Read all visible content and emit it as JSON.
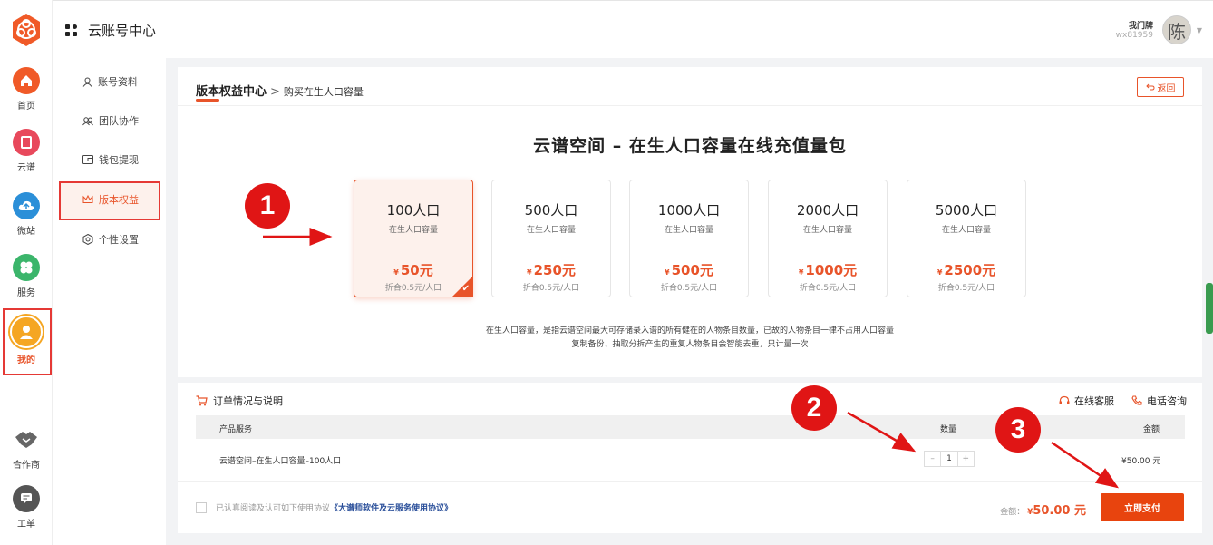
{
  "rail": {
    "items": [
      {
        "label": "首页",
        "icon": "home-icon",
        "color": "#f05a28"
      },
      {
        "label": "云谱",
        "icon": "book-icon",
        "color": "#e8495c"
      },
      {
        "label": "微站",
        "icon": "cloud-icon",
        "color": "#2b8fd8"
      },
      {
        "label": "服务",
        "icon": "clover-icon",
        "color": "#3bb56b"
      },
      {
        "label": "我的",
        "icon": "user-icon",
        "color": "#f5a623"
      },
      {
        "label": "合作商",
        "icon": "handshake-icon",
        "color": "#666666"
      },
      {
        "label": "工单",
        "icon": "chat-icon",
        "color": "#555555"
      }
    ]
  },
  "nav2": {
    "items": [
      {
        "label": "账号资料",
        "icon": "user-outline-icon"
      },
      {
        "label": "团队协作",
        "icon": "team-icon"
      },
      {
        "label": "钱包提现",
        "icon": "wallet-icon"
      },
      {
        "label": "版本权益",
        "icon": "crown-icon"
      },
      {
        "label": "个性设置",
        "icon": "settings-icon"
      }
    ]
  },
  "header": {
    "title": "云账号中心",
    "user_name": "我门牌",
    "user_id": "wx81959",
    "avatar_char": "陈"
  },
  "page": {
    "crumb_main": "版本权益中心",
    "crumb_sep": ">",
    "crumb_sub": "购买在生人口容量",
    "back_label": "返回",
    "title": "云谱空间 – 在生人口容量在线充值量包",
    "note_line1": "在生人口容量，是指云谱空间最大可存储录入谱的所有健在的人物条目数量，已故的人物条目一律不占用人口容量",
    "note_line2": "复制备份、抽取分拆产生的重复人物条目会智能去重，只计量一次"
  },
  "packages": [
    {
      "name": "100人口",
      "sub": "在生人口容量",
      "price": "50元",
      "disc": "折合0.5元/人口",
      "selected": true
    },
    {
      "name": "500人口",
      "sub": "在生人口容量",
      "price": "250元",
      "disc": "折合0.5元/人口",
      "selected": false
    },
    {
      "name": "1000人口",
      "sub": "在生人口容量",
      "price": "500元",
      "disc": "折合0.5元/人口",
      "selected": false
    },
    {
      "name": "2000人口",
      "sub": "在生人口容量",
      "price": "1000元",
      "disc": "折合0.5元/人口",
      "selected": false
    },
    {
      "name": "5000人口",
      "sub": "在生人口容量",
      "price": "2500元",
      "disc": "折合0.5元/人口",
      "selected": false
    }
  ],
  "currency_symbol": "¥",
  "order": {
    "title": "订单情况与说明",
    "online_service": "在线客服",
    "phone_consult": "电话咨询",
    "col_product": "产品服务",
    "col_qty": "数量",
    "col_amount": "金额",
    "row_product": "云谱空间–在生人口容量–100人口",
    "row_qty": "1",
    "row_amount": "¥50.00 元",
    "qty_minus": "–",
    "qty_plus": "+",
    "agree_text": "已认真阅读及认可如下使用协议",
    "agree_link": "《大谱师软件及云服务使用协议》",
    "amount_label": "金额：",
    "amount_value": "50.00 元",
    "pay_label": "立即支付"
  },
  "annotations": [
    "1",
    "2",
    "3"
  ],
  "colors": {
    "accent": "#e8542a",
    "annotation": "#e01515"
  }
}
